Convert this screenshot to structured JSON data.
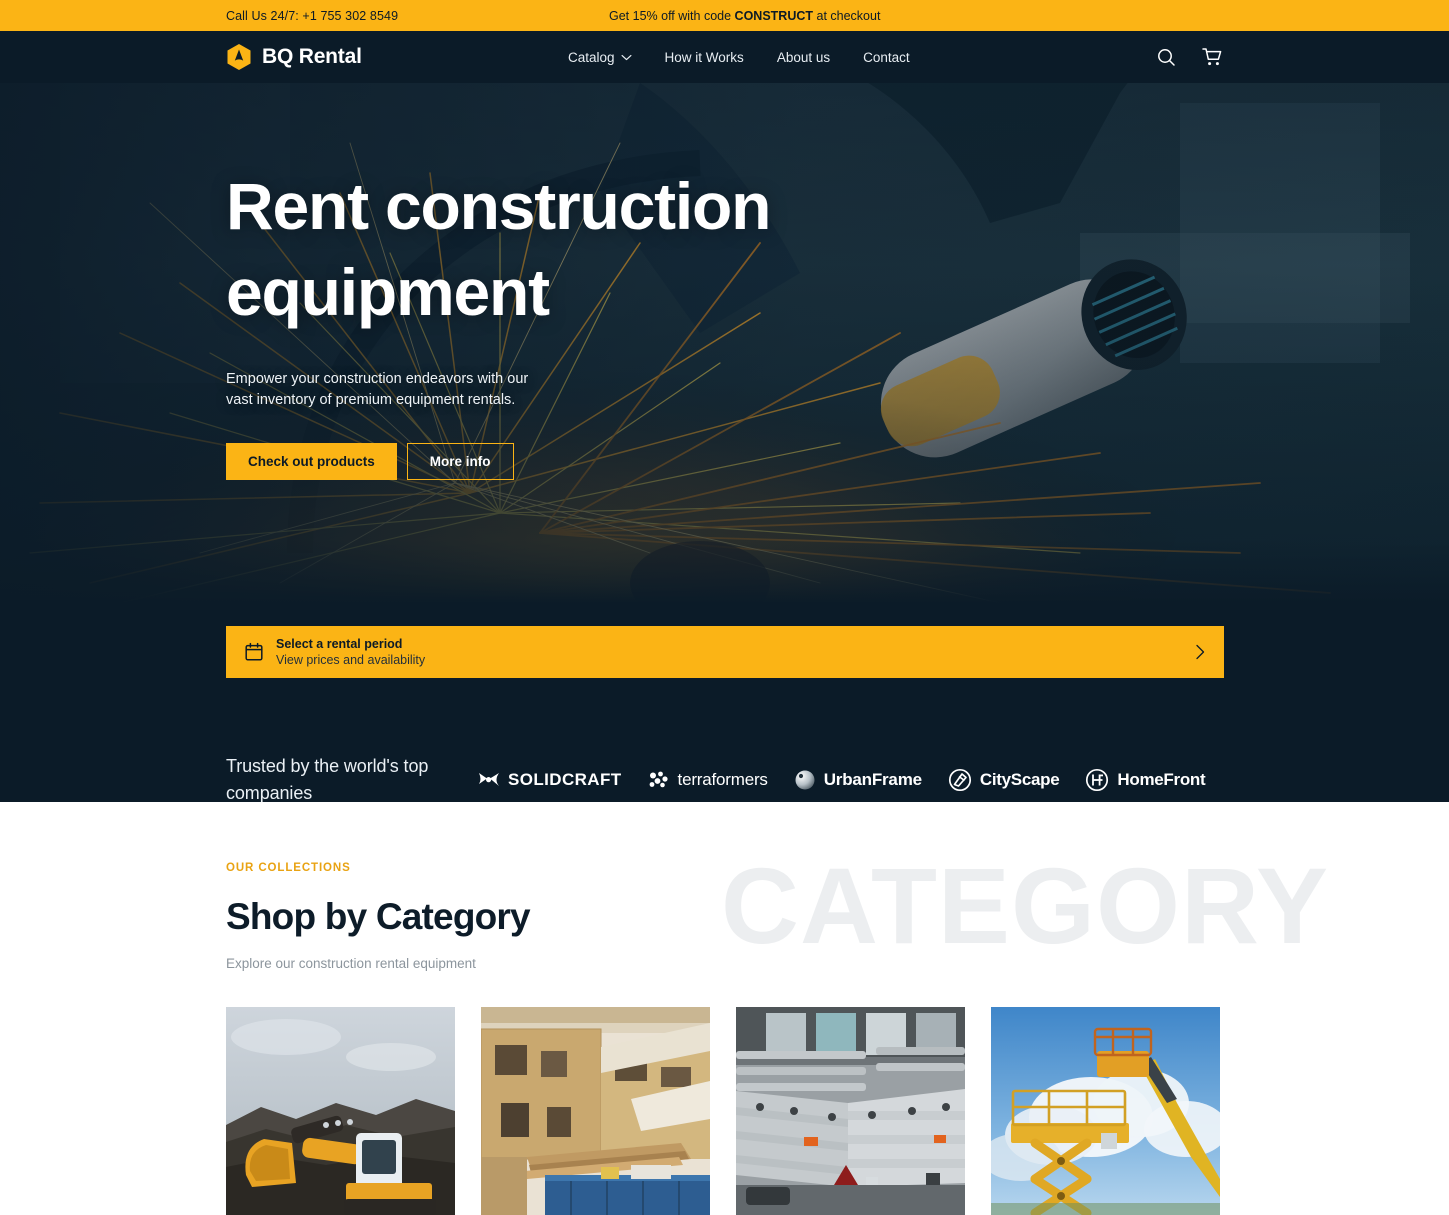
{
  "announcement": {
    "phone": "Call Us 24/7: +1 755 302 8549",
    "promo_prefix": "Get 15% off with code ",
    "promo_code": "CONSTRUCT",
    "promo_suffix": " at checkout"
  },
  "header": {
    "brand": "BQ Rental",
    "nav": [
      {
        "label": "Catalog",
        "has_dropdown": true
      },
      {
        "label": "How it Works",
        "has_dropdown": false
      },
      {
        "label": "About us",
        "has_dropdown": false
      },
      {
        "label": "Contact",
        "has_dropdown": false
      }
    ],
    "actions": [
      {
        "name": "search-icon",
        "label": "Search"
      },
      {
        "name": "cart-icon",
        "label": "Cart"
      }
    ]
  },
  "hero": {
    "title_line1": "Rent construction",
    "title_line2": "equipment",
    "subtitle": "Empower your construction endeavors with our vast inventory of premium equipment rentals.",
    "primary_button": "Check out products",
    "secondary_button": "More info"
  },
  "rental_banner": {
    "title": "Select a rental period",
    "subtitle": "View prices and availability",
    "icon": "calendar-icon",
    "chevron": "chevron-right-icon"
  },
  "trusted": {
    "label": "Trusted by the world's top companies",
    "logos": [
      {
        "name": "SOLIDCRAFT",
        "icon": "solidcraft-mark"
      },
      {
        "name": "terraformers",
        "icon": "terraformers-mark"
      },
      {
        "name": "UrbanFrame",
        "icon": "urbanframe-mark"
      },
      {
        "name": "CityScape",
        "icon": "cityscape-mark"
      },
      {
        "name": "HomeFront",
        "icon": "homefront-mark"
      }
    ]
  },
  "collections": {
    "eyebrow": "OUR COLLECTIONS",
    "title": "Shop by Category",
    "subtitle": "Explore our construction rental equipment",
    "watermark": "CATEGORY",
    "cards": [
      {
        "name": "excavator-category-card",
        "alt": "Yellow excavator on rocky ground under grey sky"
      },
      {
        "name": "timber-framing-category-card",
        "alt": "Wood framed house under construction with blue dumpster"
      },
      {
        "name": "trailer-category-card",
        "alt": "Silver utility trailer with open side walls"
      },
      {
        "name": "lift-category-card",
        "alt": "Yellow scissor lift and boom lift against blue sky"
      }
    ]
  },
  "colors": {
    "accent": "#FBB415",
    "dark": "#0B1B28",
    "eyebrow": "#E9A313",
    "watermark": "#ECEEF0",
    "muted": "#8C959D"
  }
}
